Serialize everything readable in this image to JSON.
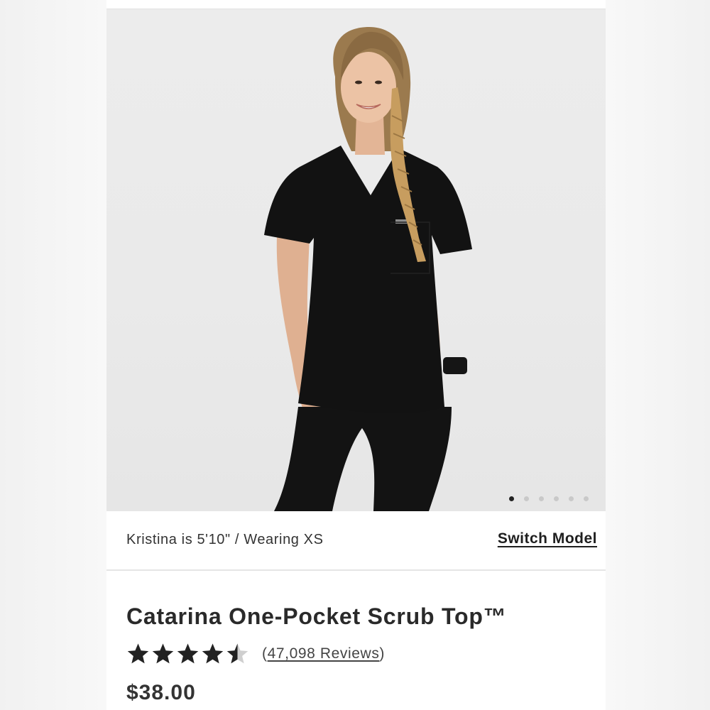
{
  "model": {
    "info": "Kristina is 5'10\" / Wearing XS",
    "switch_label": "Switch Model"
  },
  "gallery": {
    "image_count": 6,
    "active_index": 0
  },
  "product": {
    "title": "Catarina One-Pocket Scrub Top™",
    "rating": 4.5,
    "reviews_open": "(",
    "reviews_text": "47,098 Reviews",
    "reviews_close": ")",
    "price": "$38.00"
  },
  "colors": {
    "scrub": "#111111",
    "accent": "#1f1f1f",
    "background": "#ffffff",
    "photo_bg": "#ebebeb"
  }
}
